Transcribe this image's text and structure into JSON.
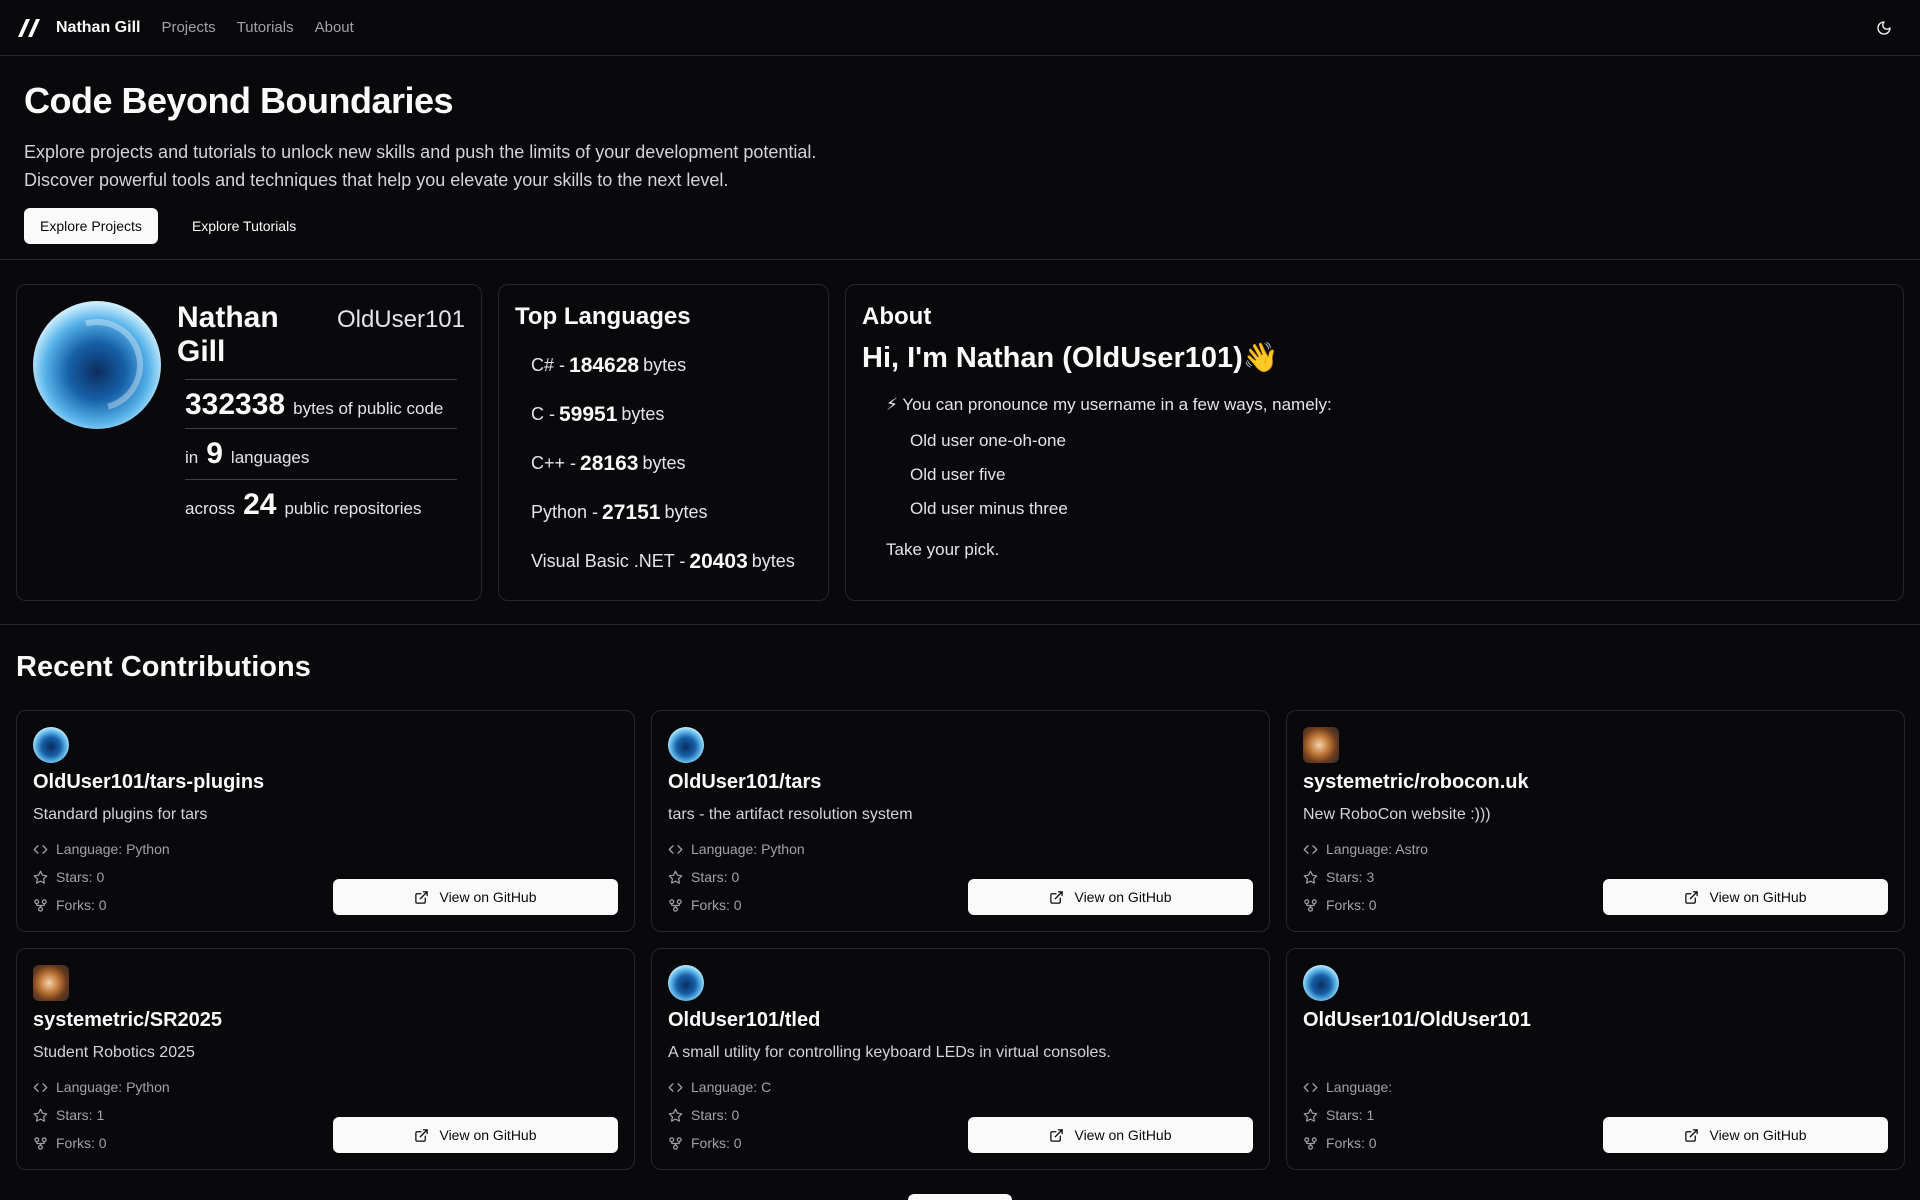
{
  "nav": {
    "logo_icon": "double-slash-logo-icon",
    "brand": "Nathan Gill",
    "links": [
      "Projects",
      "Tutorials",
      "About"
    ],
    "theme_icon": "moon-icon"
  },
  "hero": {
    "title": "Code Beyond Boundaries",
    "line1": "Explore projects and tutorials to unlock new skills and push the limits of your development potential.",
    "line2": "Discover powerful tools and techniques that help you elevate your skills to the next level.",
    "primary_button": "Explore Projects",
    "secondary_button": "Explore Tutorials"
  },
  "profile": {
    "name": "Nathan Gill",
    "username": "OldUser101",
    "bytes_value": "332338",
    "bytes_label": "bytes of public code",
    "languages_prefix": "in",
    "languages_value": "9",
    "languages_label": "languages",
    "repos_prefix": "across",
    "repos_value": "24",
    "repos_label": "public repositories"
  },
  "top_languages": {
    "title": "Top Languages",
    "unit": "bytes",
    "items": [
      {
        "name": "C# -",
        "bytes": "184628"
      },
      {
        "name": "C -",
        "bytes": "59951"
      },
      {
        "name": "C++ -",
        "bytes": "28163"
      },
      {
        "name": "Python -",
        "bytes": "27151"
      },
      {
        "name": "Visual Basic .NET -",
        "bytes": "20403"
      }
    ]
  },
  "about": {
    "title": "About",
    "greeting": "Hi, I'm Nathan (OldUser101)👋",
    "intro": "⚡ You can pronounce my username in a few ways, namely:",
    "options": [
      "Old user one-oh-one",
      "Old user five",
      "Old user minus three"
    ],
    "closing": "Take your pick."
  },
  "recent": {
    "title": "Recent Contributions",
    "button_label": "View on GitHub",
    "repos": [
      {
        "name": "OldUser101/tars-plugins",
        "desc": "Standard plugins for tars",
        "language": "Language: Python",
        "stars": "Stars: 0",
        "forks": "Forks: 0",
        "avatar": "blue"
      },
      {
        "name": "OldUser101/tars",
        "desc": "tars - the artifact resolution system",
        "language": "Language: Python",
        "stars": "Stars: 0",
        "forks": "Forks: 0",
        "avatar": "blue"
      },
      {
        "name": "systemetric/robocon.uk",
        "desc": "New RoboCon website :)))",
        "language": "Language: Astro",
        "stars": "Stars: 3",
        "forks": "Forks: 0",
        "avatar": "orange"
      },
      {
        "name": "systemetric/SR2025",
        "desc": "Student Robotics 2025",
        "language": "Language: Python",
        "stars": "Stars: 1",
        "forks": "Forks: 0",
        "avatar": "orange"
      },
      {
        "name": "OldUser101/tled",
        "desc": "A small utility for controlling keyboard LEDs in virtual consoles.",
        "language": "Language: C",
        "stars": "Stars: 0",
        "forks": "Forks: 0",
        "avatar": "blue"
      },
      {
        "name": "OldUser101/OldUser101",
        "desc": "",
        "language": "Language:",
        "stars": "Stars: 1",
        "forks": "Forks: 0",
        "avatar": "blue"
      }
    ]
  },
  "colors": {
    "background": "#09090b",
    "border": "#27272a",
    "muted_text": "#a1a1aa",
    "primary_button_bg": "#fafafa"
  }
}
